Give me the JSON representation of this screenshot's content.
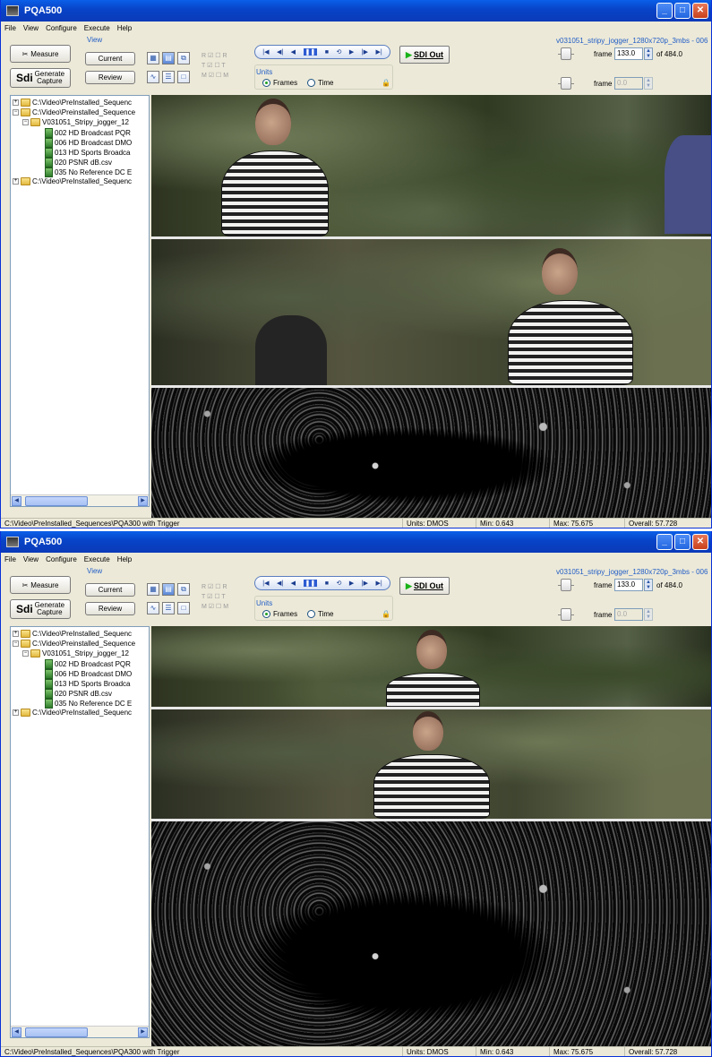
{
  "windows": [
    {
      "title": "PQA500",
      "menu": [
        "File",
        "View",
        "Configure",
        "Execute",
        "Help"
      ],
      "toolbar": {
        "measure_label": "Measure",
        "generate_label": "Generate",
        "capture_label": "Capture",
        "sdi_logo": "Sdi",
        "view_group_label": "View",
        "current_label": "Current",
        "review_label": "Review",
        "rtm": [
          "R",
          "T",
          "M"
        ],
        "units_label": "Units",
        "frames_label": "Frames",
        "time_label": "Time",
        "units_selected": "Frames",
        "sdi_out_label": "SDI Out"
      },
      "sequence": {
        "name": "v031051_stripy_jogger_1280x720p_3mbs - 006",
        "frame_label": "frame",
        "frame_value": "133.0",
        "of_label": "of 484.0",
        "frame2_value": "0.0"
      },
      "tree": [
        "C:\\Video\\PreInstalled_Sequenc",
        "C:\\Video\\Preinstalled_Sequence",
        "V031051_Stripy_jogger_12",
        "002 HD Broadcast PQR",
        "006 HD Broadcast DMO",
        "013 HD Sports Broadca",
        "020 PSNR dB.csv",
        "035 No Reference DC E",
        "C:\\Video\\PreInstalled_Sequenc"
      ],
      "status": {
        "path": "C:\\Video\\PreInstalled_Sequences\\PQA300 with Trigger",
        "units": "Units: DMOS",
        "min": "Min: 0.643",
        "max": "Max: 75.675",
        "overall": "Overall: 57.728"
      }
    },
    {
      "title": "PQA500",
      "menu": [
        "File",
        "View",
        "Configure",
        "Execute",
        "Help"
      ],
      "toolbar": {
        "measure_label": "Measure",
        "generate_label": "Generate",
        "capture_label": "Capture",
        "sdi_logo": "Sdi",
        "view_group_label": "View",
        "current_label": "Current",
        "review_label": "Review",
        "rtm": [
          "R",
          "T",
          "M"
        ],
        "units_label": "Units",
        "frames_label": "Frames",
        "time_label": "Time",
        "units_selected": "Frames",
        "sdi_out_label": "SDI Out"
      },
      "sequence": {
        "name": "v031051_stripy_jogger_1280x720p_3mbs - 006",
        "frame_label": "frame",
        "frame_value": "133.0",
        "of_label": "of 484.0",
        "frame2_value": "0.0"
      },
      "tree": [
        "C:\\Video\\PreInstalled_Sequenc",
        "C:\\Video\\Preinstalled_Sequence",
        "V031051_Stripy_jogger_12",
        "002 HD Broadcast PQR",
        "006 HD Broadcast DMO",
        "013 HD Sports Broadca",
        "020 PSNR dB.csv",
        "035 No Reference DC E",
        "C:\\Video\\PreInstalled_Sequenc"
      ],
      "status": {
        "path": "C:\\Video\\PreInstalled_Sequences\\PQA300 with Trigger",
        "units": "Units: DMOS",
        "min": "Min: 0.643",
        "max": "Max: 75.675",
        "overall": "Overall: 57.728"
      }
    }
  ]
}
